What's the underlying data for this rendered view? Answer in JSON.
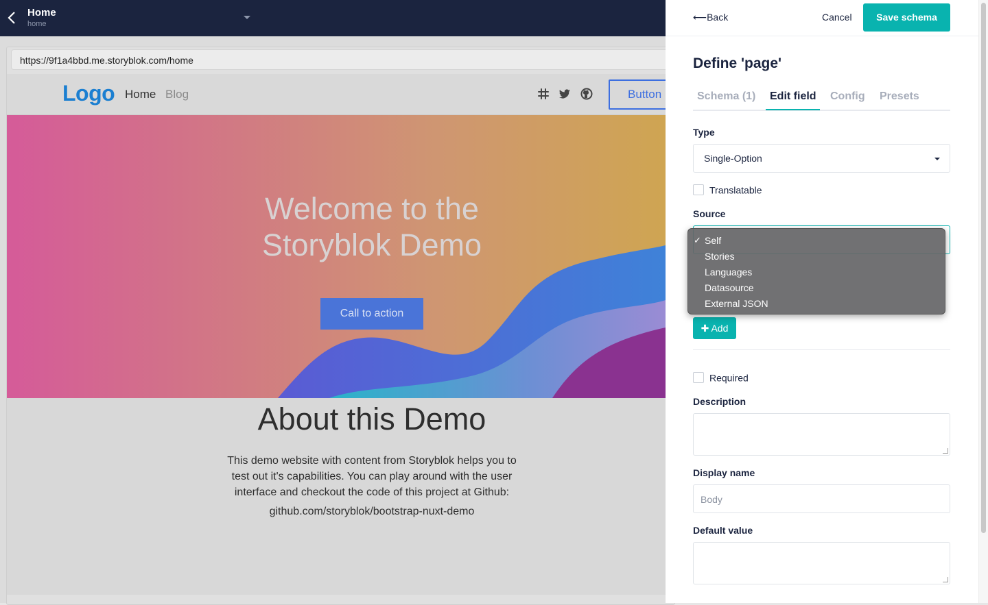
{
  "topbar": {
    "title": "Home",
    "slug": "home"
  },
  "preview": {
    "url": "https://9f1a4bbd.me.storyblok.com/home",
    "site": {
      "logo": "Logo",
      "nav": [
        "Home",
        "Blog"
      ],
      "nav_button": "Button",
      "hero_title": "Welcome to the Storyblok Demo",
      "cta": "Call to action",
      "about_title": "About this Demo",
      "about_text": "This demo website with content from Storyblok helps you to test out it's capabilities. You can play around with the user interface and checkout the code of this project at Github:",
      "about_link": "github.com/storyblok/bootstrap-nuxt-demo"
    }
  },
  "panel": {
    "back": "Back",
    "cancel": "Cancel",
    "save": "Save schema",
    "heading": "Define 'page'",
    "tabs": [
      "Schema (1)",
      "Edit field",
      "Config",
      "Presets"
    ],
    "active_tab": "Edit field",
    "type_label": "Type",
    "type_value": "Single-Option",
    "translatable": "Translatable",
    "source_label": "Source",
    "add": "Add",
    "required": "Required",
    "description_label": "Description",
    "display_name_label": "Display name",
    "display_name_placeholder": "Body",
    "default_value_label": "Default value"
  },
  "source_menu": {
    "options": [
      "Self",
      "Stories",
      "Languages",
      "Datasource",
      "External JSON"
    ],
    "selected": "Self"
  },
  "colors": {
    "accent": "#09b3af",
    "navbar": "#1b243f",
    "cta": "#4a74d8"
  }
}
